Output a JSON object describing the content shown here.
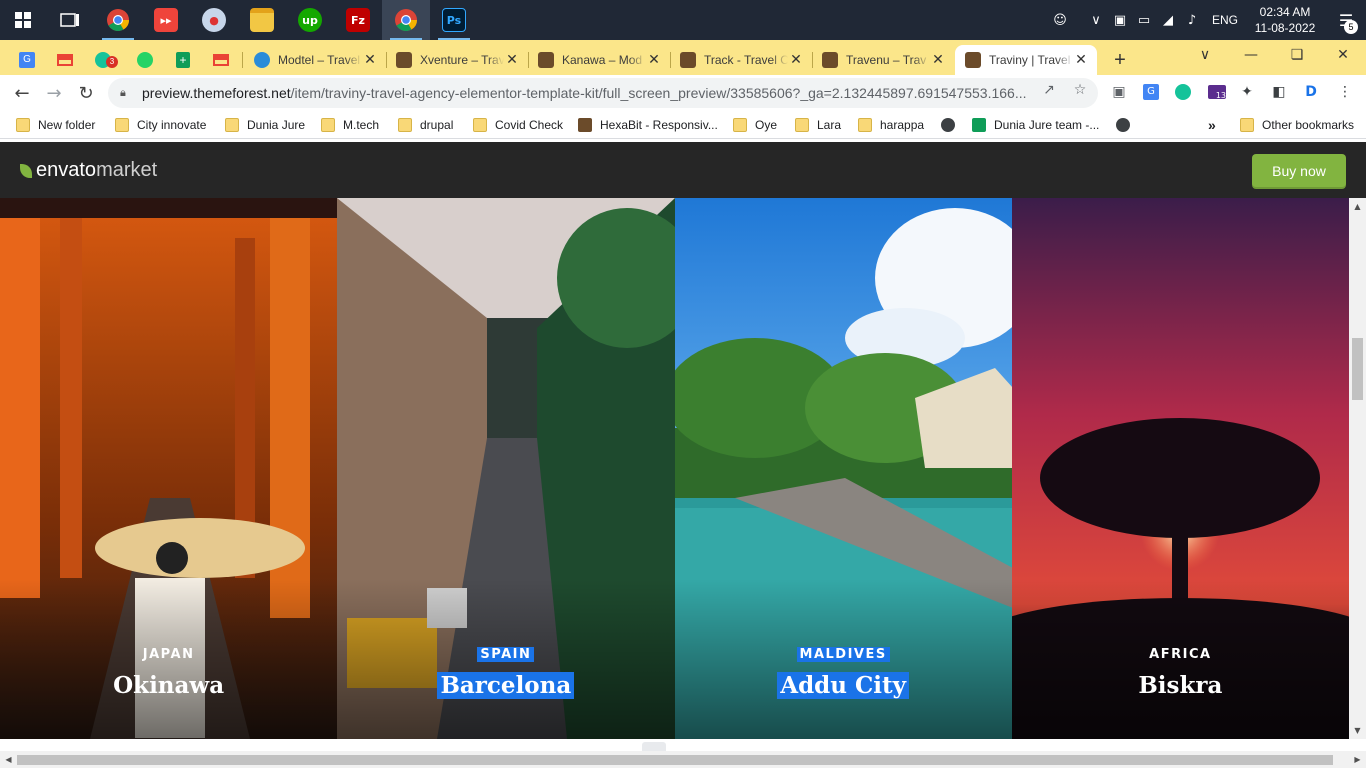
{
  "taskbar": {
    "apps": [
      {
        "icon": "task-view-icon",
        "label": ""
      },
      {
        "icon": "chrome-icon",
        "label": ""
      },
      {
        "icon": "anydesk-icon",
        "label": ""
      },
      {
        "icon": "paint-icon",
        "label": ""
      },
      {
        "icon": "file-explorer-icon",
        "label": ""
      },
      {
        "icon": "upwork-icon",
        "label": "up"
      },
      {
        "icon": "filezilla-icon",
        "label": "Fz"
      },
      {
        "icon": "chrome-profile-icon",
        "label": ""
      },
      {
        "icon": "photoshop-icon",
        "label": "Ps"
      }
    ],
    "language": "ENG",
    "time": "02:34 AM",
    "date": "11-08-2022",
    "notification_count": "5"
  },
  "tabs": {
    "pinned": [
      {
        "icon": "google-translate-icon",
        "badge": ""
      },
      {
        "icon": "gmail-icon",
        "badge": ""
      },
      {
        "icon": "grammarly-icon",
        "badge": "3"
      },
      {
        "icon": "whatsapp-icon",
        "badge": ""
      },
      {
        "icon": "google-sheets-icon",
        "badge": ""
      },
      {
        "icon": "gmail-icon",
        "badge": ""
      }
    ],
    "open": [
      {
        "title": "Modtel – Travel",
        "favicon_color": "#2b8cd9",
        "active": false
      },
      {
        "title": "Xventure – Travel",
        "favicon_color": "#6b4b2a",
        "active": false
      },
      {
        "title": "Kanawa – Mod",
        "favicon_color": "#6b4b2a",
        "active": false
      },
      {
        "title": "Track - Travel C",
        "favicon_color": "#6b4b2a",
        "active": false
      },
      {
        "title": "Travenu – Trav",
        "favicon_color": "#6b4b2a",
        "active": false
      },
      {
        "title": "Traviny | Travel",
        "favicon_color": "#6b4b2a",
        "active": true
      }
    ],
    "new_tab": "+"
  },
  "omnibox": {
    "host": "preview.themeforest.net",
    "path": "/item/traviny-travel-agency-elementor-template-kit/full_screen_preview/33585606?_ga=2.132445897.691547553.166..."
  },
  "bookmarks": [
    {
      "label": "New folder",
      "type": "folder"
    },
    {
      "label": "City innovate",
      "type": "folder"
    },
    {
      "label": "Dunia Jure",
      "type": "folder"
    },
    {
      "label": "M.tech",
      "type": "folder"
    },
    {
      "label": "drupal",
      "type": "folder"
    },
    {
      "label": "Covid Check",
      "type": "folder"
    },
    {
      "label": "HexaBit - Responsiv...",
      "type": "site"
    },
    {
      "label": "Oye",
      "type": "folder"
    },
    {
      "label": "Lara",
      "type": "folder"
    },
    {
      "label": "harappa",
      "type": "folder"
    },
    {
      "label": "",
      "type": "globe"
    },
    {
      "label": "Dunia Jure team -...",
      "type": "sheet"
    },
    {
      "label": "",
      "type": "globe"
    }
  ],
  "other_bookmarks": "Other bookmarks",
  "envato": {
    "logo_word1": "envato",
    "logo_word2": "market",
    "buy_label": "Buy now",
    "accent": "#82b440"
  },
  "destinations": [
    {
      "country": "JAPAN",
      "city": "Okinawa",
      "selected": false
    },
    {
      "country": "SPAIN",
      "city": "Barcelona",
      "selected": true
    },
    {
      "country": "MALDIVES",
      "city": "Addu City",
      "selected": true
    },
    {
      "country": "AFRICA",
      "city": "Biskra",
      "selected": false
    }
  ],
  "colors": {
    "taskbar": "#202836",
    "tabstrip": "#fbe68a",
    "selection": "#1a73e8"
  }
}
